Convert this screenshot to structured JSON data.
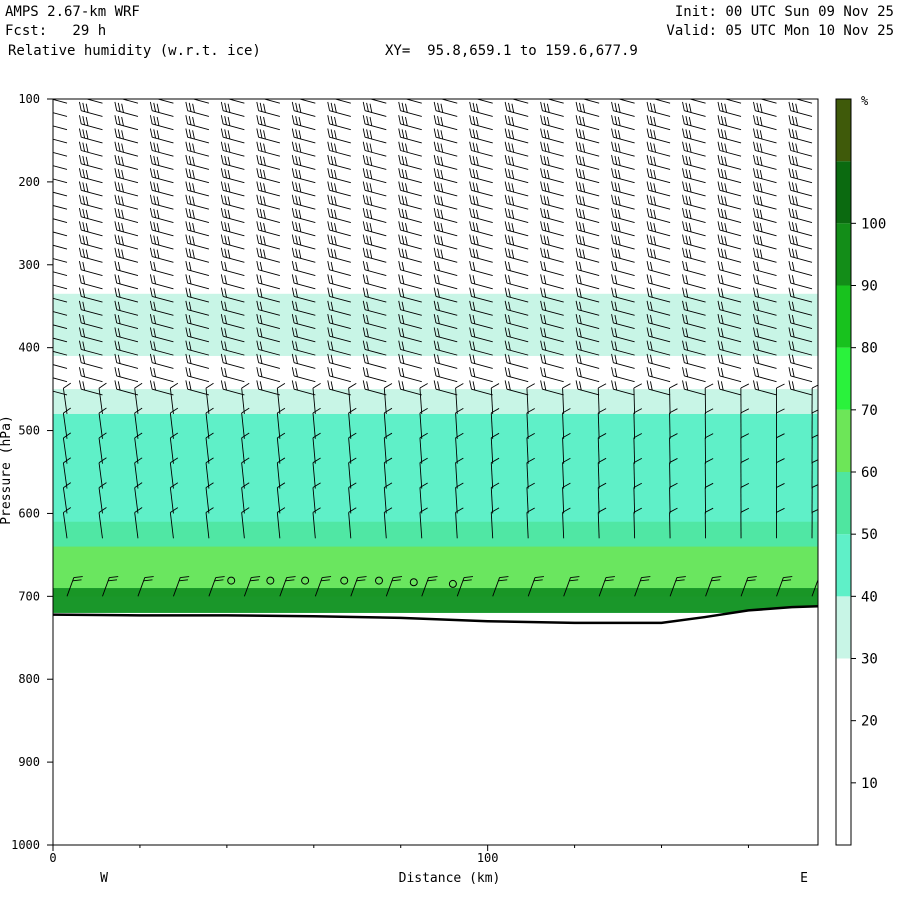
{
  "header": {
    "model": "AMPS 2.67-km WRF",
    "forecast": "Fcst:   29 h",
    "field": "Relative humidity (w.r.t. ice)",
    "xy_range": "XY=  95.8,659.1 to 159.6,677.9",
    "init": "Init: 00 UTC Sun 09 Nov 25",
    "valid": "Valid: 05 UTC Mon 10 Nov 25"
  },
  "chart_data": {
    "type": "heatmap",
    "title": "Relative humidity (w.r.t. ice)",
    "xlabel": "Distance (km)",
    "ylabel": "Pressure (hPa)",
    "xlim": [
      0,
      176
    ],
    "ylim": [
      1000,
      100
    ],
    "x_ticks": [
      0,
      100
    ],
    "y_ticks": [
      100,
      200,
      300,
      400,
      500,
      600,
      700,
      800,
      900,
      1000
    ],
    "west_label": "W",
    "east_label": "E",
    "colorbar": {
      "unit": "%",
      "levels": [
        10,
        20,
        30,
        40,
        50,
        60,
        70,
        80,
        90,
        100
      ],
      "colors": [
        "#ffffff",
        "#ffffff",
        "#ffffff",
        "#c8f5e6",
        "#5ff0c8",
        "#4fe6a0",
        "#6de658",
        "#2af23c",
        "#18c21e",
        "#138d18",
        "#0b6a10",
        "#3f5a0a"
      ]
    },
    "layers": [
      {
        "p_top": 335,
        "p_bottom": 410,
        "rh": "30-40",
        "color": "#c8f5e6"
      },
      {
        "p_top": 450,
        "p_bottom": 480,
        "rh": "30-40",
        "color": "#c8f5e6"
      },
      {
        "p_top": 480,
        "p_bottom": 720,
        "rh": "40-50",
        "color": "#5ff0c8"
      },
      {
        "p_top": 610,
        "p_bottom": 700,
        "rh": "50-60",
        "color": "#4fe6a0"
      },
      {
        "p_top": 640,
        "p_bottom": 690,
        "rh": "60-70",
        "color": "#6de658"
      },
      {
        "p_top": 690,
        "p_bottom": 720,
        "rh": "70-100",
        "color": "#138d18"
      }
    ],
    "terrain_pressure": {
      "x": [
        0,
        20,
        40,
        60,
        80,
        100,
        120,
        140,
        150,
        160,
        170,
        176
      ],
      "p": [
        722,
        723,
        723,
        724,
        726,
        730,
        732,
        732,
        725,
        717,
        713,
        712
      ]
    },
    "calm_points": {
      "x": [
        41,
        50,
        58,
        67,
        75,
        83,
        92
      ],
      "p": [
        681,
        681,
        681,
        681,
        681,
        683,
        685
      ]
    }
  }
}
